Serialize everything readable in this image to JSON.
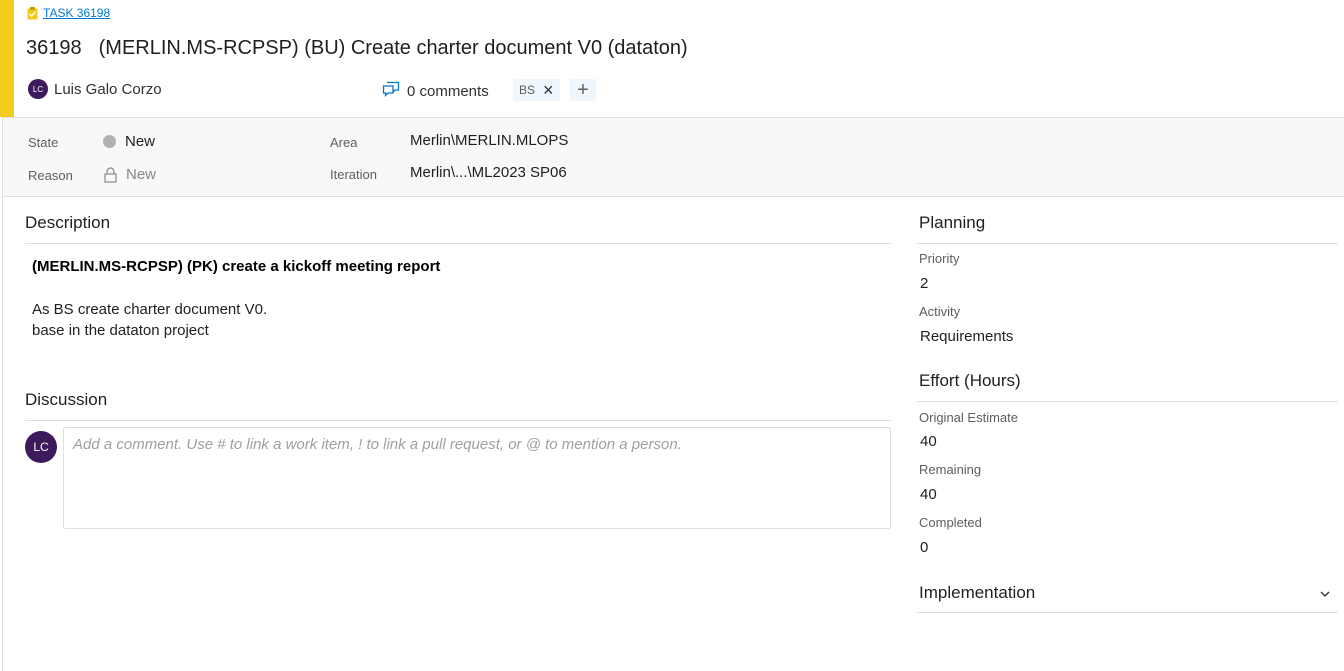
{
  "header": {
    "task_link": "TASK 36198",
    "work_item_id": "36198",
    "title": "(MERLIN.MS-RCPSP) (BU) Create charter document V0 (dataton)",
    "assignee": {
      "initials": "LC",
      "name": "Luis Galo Corzo"
    },
    "comments": "0 comments",
    "tags": [
      "BS"
    ],
    "accent_color": "#f2cb1d"
  },
  "fields": {
    "state": {
      "label": "State",
      "value": "New"
    },
    "reason": {
      "label": "Reason",
      "value": "New"
    },
    "area": {
      "label": "Area",
      "value": "Merlin\\MERLIN.MLOPS"
    },
    "iteration": {
      "label": "Iteration",
      "value": "Merlin\\...\\ML2023 SP06"
    }
  },
  "description": {
    "heading": "Description",
    "bold_line": "(MERLIN.MS-RCPSP) (PK)  create a kickoff meeting report",
    "lines": [
      "As BS create charter document V0.",
      "base in the dataton project"
    ]
  },
  "discussion": {
    "heading": "Discussion",
    "avatar_initials": "LC",
    "placeholder": "Add a comment. Use # to link a work item, ! to link a pull request, or @ to mention a person."
  },
  "planning": {
    "heading": "Planning",
    "priority": {
      "label": "Priority",
      "value": "2"
    },
    "activity": {
      "label": "Activity",
      "value": "Requirements"
    }
  },
  "effort": {
    "heading": "Effort (Hours)",
    "original": {
      "label": "Original Estimate",
      "value": "40"
    },
    "remaining": {
      "label": "Remaining",
      "value": "40"
    },
    "completed": {
      "label": "Completed",
      "value": "0"
    }
  },
  "implementation": {
    "heading": "Implementation"
  },
  "colors": {
    "accent": "#f2cb1d",
    "avatar": "#3d1a5b",
    "link": "#0078d4"
  }
}
